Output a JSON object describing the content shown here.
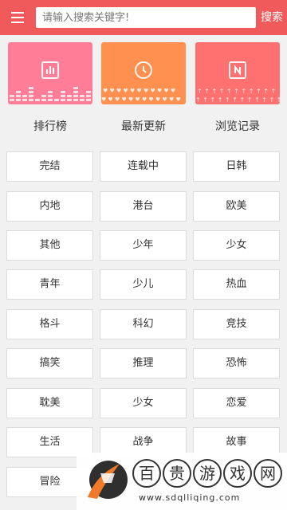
{
  "header": {
    "search_placeholder": "请输入搜索关键字!",
    "search_button": "搜索",
    "menu_icon": "hamburger-menu-icon"
  },
  "quick_links": [
    {
      "label": "排行榜",
      "icon": "bar-chart-icon",
      "color": "#ff7d97"
    },
    {
      "label": "最新更新",
      "icon": "clock-icon",
      "color": "#ff9050"
    },
    {
      "label": "浏览记录",
      "icon": "history-book-icon",
      "color": "#ff7070"
    }
  ],
  "categories": [
    "完结",
    "连载中",
    "日韩",
    "内地",
    "港台",
    "欧美",
    "其他",
    "少年",
    "少女",
    "青年",
    "少儿",
    "热血",
    "格斗",
    "科幻",
    "竞技",
    "搞笑",
    "推理",
    "恐怖",
    "耽美",
    "少女",
    "恋爱",
    "生活",
    "战争",
    "故事",
    "冒险"
  ],
  "watermark": {
    "chars": [
      "百",
      "贵",
      "游",
      "戏",
      "网"
    ],
    "url": "www.sdqlliqing.com"
  },
  "colors": {
    "header": "#f05a5a"
  }
}
